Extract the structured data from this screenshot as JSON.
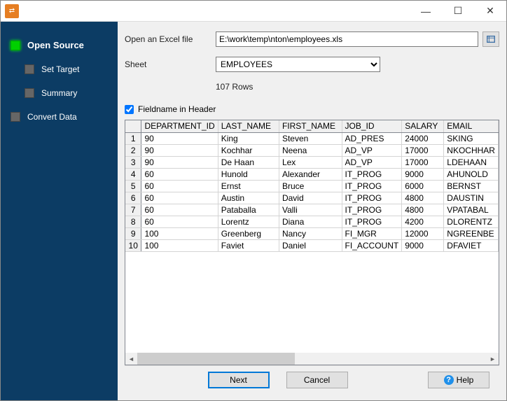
{
  "titlebar": {
    "min": "—",
    "max": "☐",
    "close": "✕"
  },
  "sidebar": {
    "items": [
      {
        "label": "Open Source",
        "active": true
      },
      {
        "label": "Set Target",
        "active": false
      },
      {
        "label": "Summary",
        "active": false
      },
      {
        "label": "Convert Data",
        "active": false
      }
    ]
  },
  "form": {
    "file_label": "Open an Excel file",
    "file_value": "E:\\work\\temp\\nton\\employees.xls",
    "sheet_label": "Sheet",
    "sheet_value": "EMPLOYEES",
    "rows_text": "107 Rows",
    "fieldname_label": "Fieldname in Header",
    "fieldname_checked": true
  },
  "grid": {
    "columns": [
      "DEPARTMENT_ID",
      "LAST_NAME",
      "FIRST_NAME",
      "JOB_ID",
      "SALARY",
      "EMAIL"
    ],
    "rows": [
      [
        "90",
        "King",
        "Steven",
        "AD_PRES",
        "24000",
        "SKING"
      ],
      [
        "90",
        "Kochhar",
        "Neena",
        "AD_VP",
        "17000",
        "NKOCHHAR"
      ],
      [
        "90",
        "De Haan",
        "Lex",
        "AD_VP",
        "17000",
        "LDEHAAN"
      ],
      [
        "60",
        "Hunold",
        "Alexander",
        "IT_PROG",
        "9000",
        "AHUNOLD"
      ],
      [
        "60",
        "Ernst",
        "Bruce",
        "IT_PROG",
        "6000",
        "BERNST"
      ],
      [
        "60",
        "Austin",
        "David",
        "IT_PROG",
        "4800",
        "DAUSTIN"
      ],
      [
        "60",
        "Pataballa",
        "Valli",
        "IT_PROG",
        "4800",
        "VPATABAL"
      ],
      [
        "60",
        "Lorentz",
        "Diana",
        "IT_PROG",
        "4200",
        "DLORENTZ"
      ],
      [
        "100",
        "Greenberg",
        "Nancy",
        "FI_MGR",
        "12000",
        "NGREENBE"
      ],
      [
        "100",
        "Faviet",
        "Daniel",
        "FI_ACCOUNT",
        "9000",
        "DFAVIET"
      ]
    ]
  },
  "buttons": {
    "next": "Next",
    "cancel": "Cancel",
    "help": "Help"
  }
}
